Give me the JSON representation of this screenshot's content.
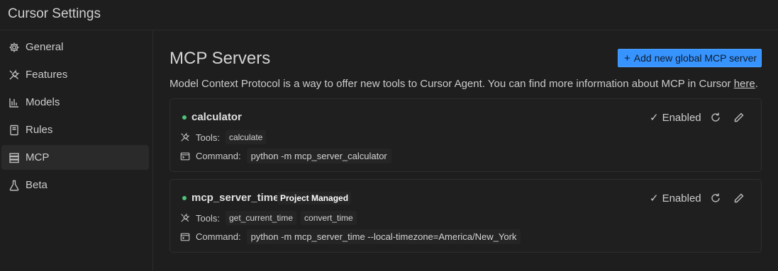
{
  "app": {
    "title": "Cursor Settings"
  },
  "sidebar": {
    "items": [
      {
        "label": "General",
        "icon": "gear-icon"
      },
      {
        "label": "Features",
        "icon": "tools-icon"
      },
      {
        "label": "Models",
        "icon": "bar-chart-icon"
      },
      {
        "label": "Rules",
        "icon": "book-icon"
      },
      {
        "label": "MCP",
        "icon": "server-icon",
        "active": true
      },
      {
        "label": "Beta",
        "icon": "flask-icon"
      }
    ]
  },
  "main": {
    "title": "MCP Servers",
    "add_button": "Add new global MCP server",
    "description": "Model Context Protocol is a way to offer new tools to Cursor Agent. You can find more information about MCP in Cursor ",
    "description_link": "here",
    "description_end": "."
  },
  "servers": [
    {
      "name": "calculator",
      "badge": "",
      "status": "Enabled",
      "tools_label": "Tools:",
      "tools": [
        "calculate"
      ],
      "command_label": "Command:",
      "command": "python -m mcp_server_calculator"
    },
    {
      "name": "mcp_server_time",
      "badge": "Project Managed",
      "status": "Enabled",
      "tools_label": "Tools:",
      "tools": [
        "get_current_time",
        "convert_time"
      ],
      "command_label": "Command:",
      "command": "python -m mcp_server_time --local-timezone=America/New_York"
    }
  ],
  "colors": {
    "accent": "#3794ff",
    "status_dot": "#4ec47a",
    "background": "#1e1e1e"
  }
}
